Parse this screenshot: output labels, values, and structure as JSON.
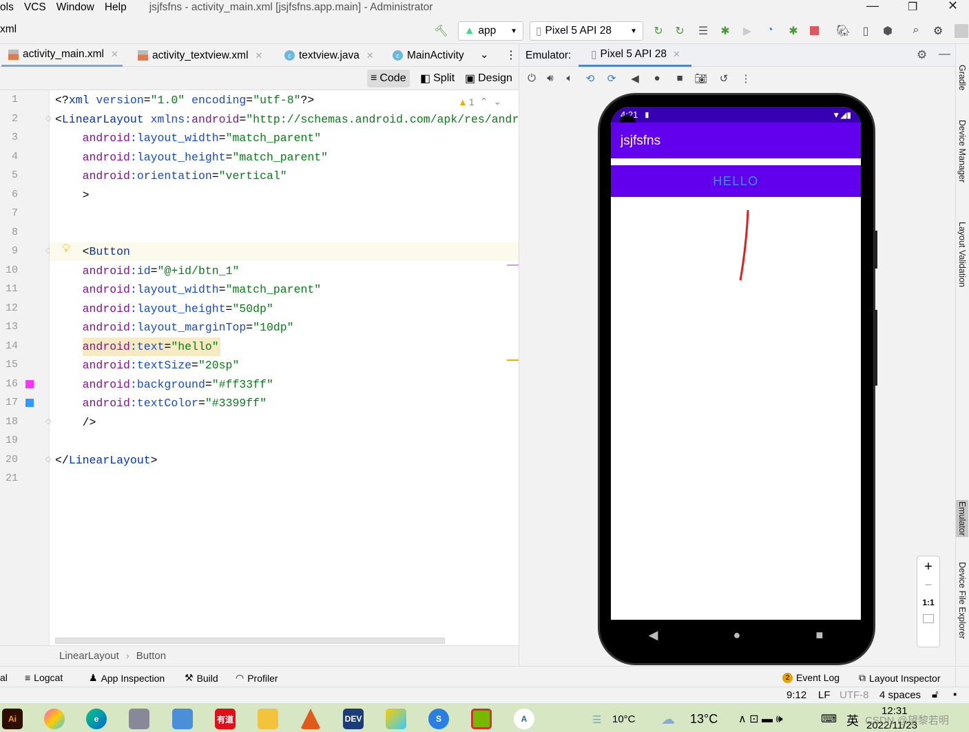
{
  "menu": [
    "ols",
    "VCS",
    "Window",
    "Help"
  ],
  "window_title": "jsjfsfns - activity_main.xml [jsjfsfns.app.main] - Administrator",
  "toolbar": {
    "breadcrumb": "xml",
    "run_config": "app",
    "device": "Pixel 5 API 28"
  },
  "editor_tabs": [
    {
      "label": "activity_main.xml",
      "icon": "xml-file-icon",
      "active": true
    },
    {
      "label": "activity_textview.xml",
      "icon": "xml-file-icon"
    },
    {
      "label": "textview.java",
      "icon": "class-icon"
    },
    {
      "label": "MainActivity",
      "icon": "class-icon"
    }
  ],
  "view_modes": [
    "Code",
    "Split",
    "Design"
  ],
  "warnings": {
    "count": "1"
  },
  "code": [
    [
      [
        "pun",
        "<?"
      ],
      [
        "tag",
        "xml "
      ],
      [
        "name",
        "version"
      ],
      [
        "pun",
        "="
      ],
      [
        "val",
        "\"1.0\""
      ],
      [
        "pun",
        " "
      ],
      [
        "name",
        "encoding"
      ],
      [
        "pun",
        "="
      ],
      [
        "val",
        "\"utf-8\""
      ],
      [
        "pun",
        "?>"
      ]
    ],
    [
      [
        "pun",
        "<"
      ],
      [
        "tag",
        "LinearLayout "
      ],
      [
        "name",
        "xmlns:"
      ],
      [
        "attr",
        "android"
      ],
      [
        "pun",
        "="
      ],
      [
        "val",
        "\"http://schemas.android.com/apk/res/android\""
      ]
    ],
    [
      [
        "pun",
        "    "
      ],
      [
        "attr",
        "android"
      ],
      [
        "name",
        ":layout_width"
      ],
      [
        "pun",
        "="
      ],
      [
        "val",
        "\"match_parent\""
      ]
    ],
    [
      [
        "pun",
        "    "
      ],
      [
        "attr",
        "android"
      ],
      [
        "name",
        ":layout_height"
      ],
      [
        "pun",
        "="
      ],
      [
        "val",
        "\"match_parent\""
      ]
    ],
    [
      [
        "pun",
        "    "
      ],
      [
        "attr",
        "android"
      ],
      [
        "name",
        ":orientation"
      ],
      [
        "pun",
        "="
      ],
      [
        "val",
        "\"vertical\""
      ]
    ],
    [
      [
        "pun",
        "    >"
      ]
    ],
    [],
    [],
    [
      [
        "pun",
        "    <"
      ],
      [
        "tag",
        "Button"
      ]
    ],
    [
      [
        "pun",
        "    "
      ],
      [
        "attr",
        "android"
      ],
      [
        "name",
        ":id"
      ],
      [
        "pun",
        "="
      ],
      [
        "val",
        "\"@+id/btn_1\""
      ]
    ],
    [
      [
        "pun",
        "    "
      ],
      [
        "attr",
        "android"
      ],
      [
        "name",
        ":layout_width"
      ],
      [
        "pun",
        "="
      ],
      [
        "val",
        "\"match_parent\""
      ]
    ],
    [
      [
        "pun",
        "    "
      ],
      [
        "attr",
        "android"
      ],
      [
        "name",
        ":layout_height"
      ],
      [
        "pun",
        "="
      ],
      [
        "val",
        "\"50dp\""
      ]
    ],
    [
      [
        "pun",
        "    "
      ],
      [
        "attr",
        "android"
      ],
      [
        "name",
        ":layout_marginTop"
      ],
      [
        "pun",
        "="
      ],
      [
        "val",
        "\"10dp\""
      ]
    ],
    [
      [
        "pun",
        "    "
      ],
      [
        "attr",
        "android"
      ],
      [
        "name",
        ":text"
      ],
      [
        "pun",
        "="
      ],
      [
        "val",
        "\"hello\""
      ]
    ],
    [
      [
        "pun",
        "    "
      ],
      [
        "attr",
        "android"
      ],
      [
        "name",
        ":textSize"
      ],
      [
        "pun",
        "="
      ],
      [
        "val",
        "\"20sp\""
      ]
    ],
    [
      [
        "pun",
        "    "
      ],
      [
        "attr",
        "android"
      ],
      [
        "name",
        ":background"
      ],
      [
        "pun",
        "="
      ],
      [
        "val",
        "\"#ff33ff\""
      ]
    ],
    [
      [
        "pun",
        "    "
      ],
      [
        "attr",
        "android"
      ],
      [
        "name",
        ":textColor"
      ],
      [
        "pun",
        "="
      ],
      [
        "val",
        "\"#3399ff\""
      ]
    ],
    [
      [
        "pun",
        "    />"
      ]
    ],
    [],
    [
      [
        "pun",
        "</"
      ],
      [
        "tag",
        "LinearLayout"
      ],
      [
        "pun",
        ">"
      ]
    ],
    []
  ],
  "swatches": {
    "16": "#ff33ff",
    "17": "#3399ff"
  },
  "breadcrumb": [
    "LinearLayout",
    "Button"
  ],
  "emulator": {
    "label": "Emulator:",
    "tab": "Pixel 5 API 28",
    "controls": [
      "power-icon",
      "volume-up-icon",
      "volume-down-icon",
      "rotate-left-icon",
      "rotate-right-icon",
      "back-icon",
      "home-icon",
      "overview-icon",
      "screenshot-icon",
      "snapshot-icon",
      "more-icon"
    ],
    "zoom": [
      "+",
      "−",
      "1:1"
    ]
  },
  "phone": {
    "time": "4:21",
    "app_title": "jsjfsfns",
    "button_text": "HELLO",
    "colors": {
      "status": "#3700b3",
      "appbar": "#6200ee",
      "button_text": "#3399ff",
      "stroke": "#e02020"
    }
  },
  "right_sidebar": [
    "Gradle",
    "Device Manager",
    "Layout Validation",
    "Emulator",
    "Device File Explorer"
  ],
  "tool_windows": [
    "al",
    "Logcat",
    "App Inspection",
    "Build",
    "Profiler"
  ],
  "tool_windows_right": {
    "event_log": "Event Log",
    "event_count": "2",
    "layout_inspector": "Layout Inspector"
  },
  "status": {
    "position": "9:12",
    "line_sep": "LF",
    "encoding": "UTF-8",
    "indent": "4 spaces"
  },
  "taskbar": {
    "weather1": "10°C",
    "weather2": "13°C",
    "ime": "英",
    "time": "12:31",
    "date": "2022/11/23",
    "watermark": "CSDN @望黎若明"
  }
}
